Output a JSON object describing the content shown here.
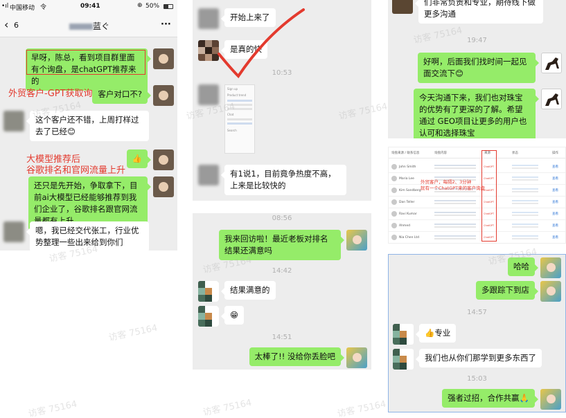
{
  "left_phone": {
    "status_bar": {
      "carrier": "中国移动",
      "time": "09:41",
      "battery": "50%"
    },
    "nav": {
      "back_count": "6",
      "title": "蓝ぐ",
      "more": "···"
    },
    "messages": [
      {
        "side": "out",
        "text": "早呀，陈总，看到项目群里面有个询盘，是chatGPT推荐来的"
      },
      {
        "side": "out",
        "text": "客户对口不?"
      },
      {
        "side": "in",
        "text": "这个客户还不错，上周打样过去了已经😊"
      },
      {
        "side": "out",
        "text": "👍"
      },
      {
        "side": "out",
        "text": "还只是先开始，争取拿下，目前ai大模型已经能够推荐到我们企业了，谷歌排名跟官网流量都有上升"
      },
      {
        "side": "in",
        "text": "嗯，我已经交代张工，行业优势整理一些出来给到你们"
      }
    ],
    "annotations": {
      "inquiry": "外贸客户-GPT获取询盘",
      "llm_line1": "大模型推荐后",
      "llm_line2": "谷歌排名和官网流量上升"
    }
  },
  "middle_top": {
    "messages": [
      {
        "side": "in",
        "text": "开始上来了"
      },
      {
        "side": "in",
        "text": "是真的快"
      },
      {
        "side": "in",
        "text": "有1说1，目前竟争热度不高，上来是比较快的"
      }
    ],
    "timestamp": "10:53",
    "screenshot_lines": [
      "Sign up",
      "Product trend",
      "Chat",
      "Search"
    ]
  },
  "middle_bottom": {
    "timestamps": [
      "08:56",
      "14:42",
      "14:51"
    ],
    "messages": [
      {
        "side": "out",
        "text": "我来回访啦！最近老板对排名结果还满意吗"
      },
      {
        "side": "in",
        "text": "结果满意的"
      },
      {
        "side": "in",
        "text": "😁"
      },
      {
        "side": "out",
        "text": "太棒了!! 没给你丢脸吧"
      }
    ]
  },
  "right_top": {
    "messages": [
      {
        "side": "in",
        "text": "们非常负责和专业，期待线下做更多沟通"
      },
      {
        "side": "out",
        "text": "好啊，后面我们找时间一起见面交流下😊"
      },
      {
        "side": "out",
        "text": "今天沟通下来，我们也对珠宝的优势有了更深的了解。希望通过 GEO项目让更多的用户也认可和选择珠宝"
      }
    ],
    "timestamp": "19:47"
  },
  "right_table": {
    "headers": [
      "询盘来源 / 联系信息",
      "询盘内容",
      "来源",
      "状态",
      "操作"
    ],
    "rows": [
      {
        "name": "John Smith",
        "source": "ChatGPT",
        "action": "查看"
      },
      {
        "name": "Maria Lee",
        "source": "ChatGPT",
        "action": "查看"
      },
      {
        "name": "Kim Sandberg",
        "source": "ChatGPT",
        "action": "查看"
      },
      {
        "name": "Dan Teller",
        "source": "ChatGPT",
        "action": "查看"
      },
      {
        "name": "Ravi Kumar",
        "source": "ChatGPT",
        "action": "查看"
      },
      {
        "name": "Ahmed",
        "source": "ChatGPT",
        "action": "查看"
      },
      {
        "name": "Nia Chen Ltd",
        "source": "ChatGPT",
        "action": "查看"
      }
    ],
    "annotation_line1": "外贸客户，每隔2、3分钟",
    "annotation_line2": "就有一个ChatGPT来的客户询盘"
  },
  "right_bottom": {
    "timestamps": [
      "14:57",
      "15:03"
    ],
    "messages": [
      {
        "side": "out",
        "text": "哈哈"
      },
      {
        "side": "out",
        "text": "多跟踪下到店"
      },
      {
        "side": "in",
        "text": "👍专业"
      },
      {
        "side": "in",
        "text": "我们也从你们那学到更多东西了"
      },
      {
        "side": "out",
        "text": "强者过招，合作共赢🙏"
      }
    ]
  },
  "watermark": "访客 75164",
  "colors": {
    "chat_bg": "#ededed",
    "out_bubble": "#95ec69",
    "in_bubble": "#ffffff",
    "annotation_red": "#e33a2e",
    "check_mark_red": "#e33a2e",
    "frame_blue": "#8fb4e6"
  }
}
